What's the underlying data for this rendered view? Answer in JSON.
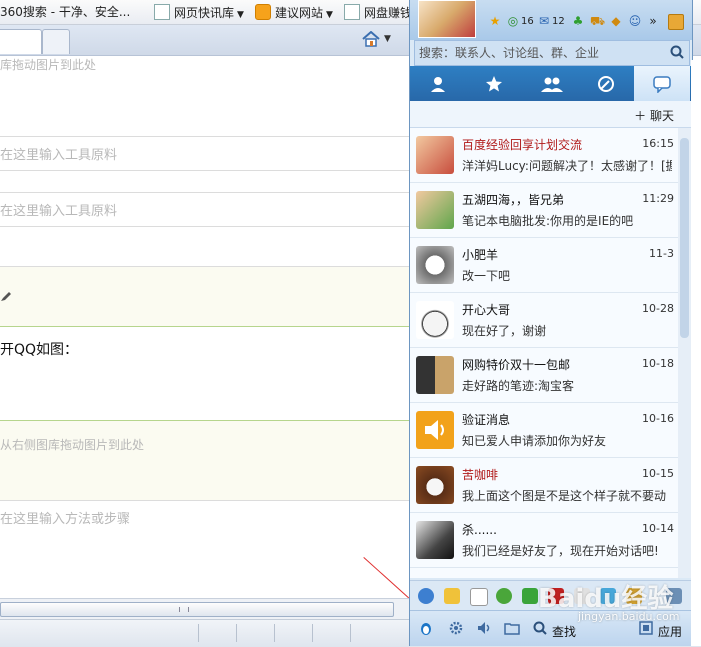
{
  "browser": {
    "bookmarks": [
      {
        "label": "360搜索 - 干净、安全...",
        "icon": "page-icon"
      },
      {
        "label": "网页快讯库",
        "icon": "page-icon"
      },
      {
        "label": "建议网站",
        "icon": "bing-icon"
      },
      {
        "label": "网盘赚钱",
        "icon": "page-icon"
      }
    ]
  },
  "editor": {
    "drop_image_hint_1": "库拖动图片到此处",
    "tool_hint_1": "在这里输入工具原料",
    "tool_hint_2": "在这里输入工具原料",
    "step_text": "开QQ如图：",
    "drop_image_hint_2": "从右侧图库拖动图片到此处",
    "method_hint": "在这里输入方法或步骤"
  },
  "qq": {
    "toolbar": {
      "count_1": "16",
      "count_2": "12"
    },
    "search": {
      "placeholder": "搜索：联系人、讨论组、群、企业"
    },
    "nav_tabs": [
      "contacts",
      "favorites",
      "groups",
      "qzone",
      "chat"
    ],
    "chat_header": "＋ 聊天",
    "conversations": [
      {
        "name": "百度经验回享计划交流",
        "name_color": "red",
        "time": "16:15",
        "message": "洋洋妈Lucy:问题解决了！太感谢了！[握",
        "avatar": "group-avatar"
      },
      {
        "name": "五湖四海，，皆兄弟",
        "name_color": "black",
        "time": "11:29",
        "message": "笔记本电脑批发:你用的是IE的吧",
        "avatar": "group-avatar"
      },
      {
        "name": "小肥羊",
        "name_color": "black",
        "time": "11-3",
        "message": "改一下吧",
        "avatar": "sheep-avatar"
      },
      {
        "name": "开心大哥",
        "name_color": "black",
        "time": "10-28",
        "message": "现在好了，谢谢",
        "avatar": "chef-avatar"
      },
      {
        "name": "网购特价双十一包邮",
        "name_color": "black",
        "time": "10-18",
        "message": "走好路的笔迹:淘宝客",
        "avatar": "multi-avatar"
      },
      {
        "name": "验证消息",
        "name_color": "black",
        "time": "10-16",
        "message": "知已爱人申请添加你为好友",
        "avatar": "speaker-avatar"
      },
      {
        "name": "苦咖啡",
        "name_color": "red",
        "time": "10-15",
        "message": "我上面这个图是不是这个样子就不要动",
        "avatar": "coffee-avatar"
      },
      {
        "name": "杀......",
        "name_color": "black",
        "time": "10-14",
        "message": "我们已经是好友了，现在开始对话吧!",
        "avatar": "anime-avatar"
      }
    ],
    "bottom": {
      "find_label": "查找",
      "apps_label": "应用"
    }
  },
  "watermark": {
    "logo": "Baidu经验",
    "sub": "jingyan.baidu.com"
  }
}
